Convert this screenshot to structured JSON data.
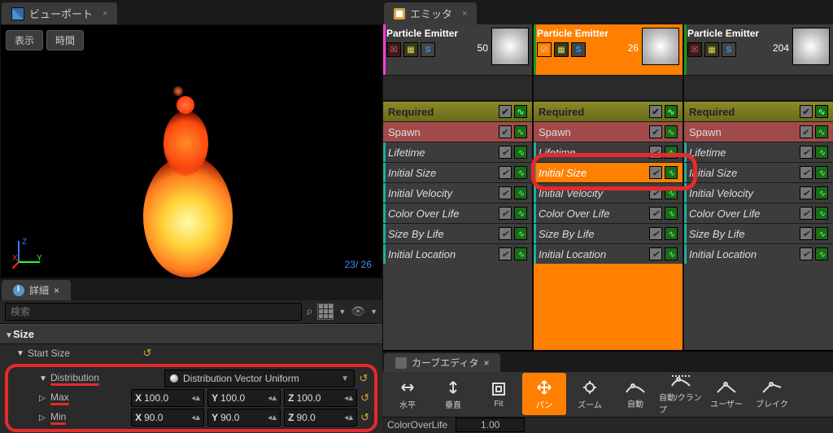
{
  "viewport": {
    "tab": "ビューポート",
    "btn_display": "表示",
    "btn_time": "時間",
    "stats": "23/  26"
  },
  "details": {
    "tab": "詳細",
    "search_placeholder": "検索",
    "category": "Size",
    "start_size": "Start Size",
    "distribution_label": "Distribution",
    "distribution_value": "Distribution Vector Uniform",
    "max_label": "Max",
    "min_label": "Min",
    "max": {
      "x": "100.0",
      "y": "100.0",
      "z": "100.0"
    },
    "minv": {
      "x": "90.0",
      "y": "90.0",
      "z": "90.0"
    }
  },
  "emitters": {
    "tab": "エミッタ",
    "header_name": "Particle Emitter",
    "counts": [
      "50",
      "26",
      "204"
    ],
    "modules": {
      "required": "Required",
      "spawn": "Spawn",
      "lifetime": "Lifetime",
      "initial_size": "Initial Size",
      "initial_velocity": "Initial Velocity",
      "color_over_life": "Color Over Life",
      "size_by_life": "Size By Life",
      "initial_location": "Initial Location"
    }
  },
  "curve": {
    "tab": "カーブエディタ",
    "tools": [
      "水平",
      "垂直",
      "Fit",
      "パン",
      "ズーム",
      "自動",
      "自動/クランプ",
      "ユーザー",
      "ブレイク"
    ],
    "track": "ColorOverLife",
    "value": "1.00"
  }
}
